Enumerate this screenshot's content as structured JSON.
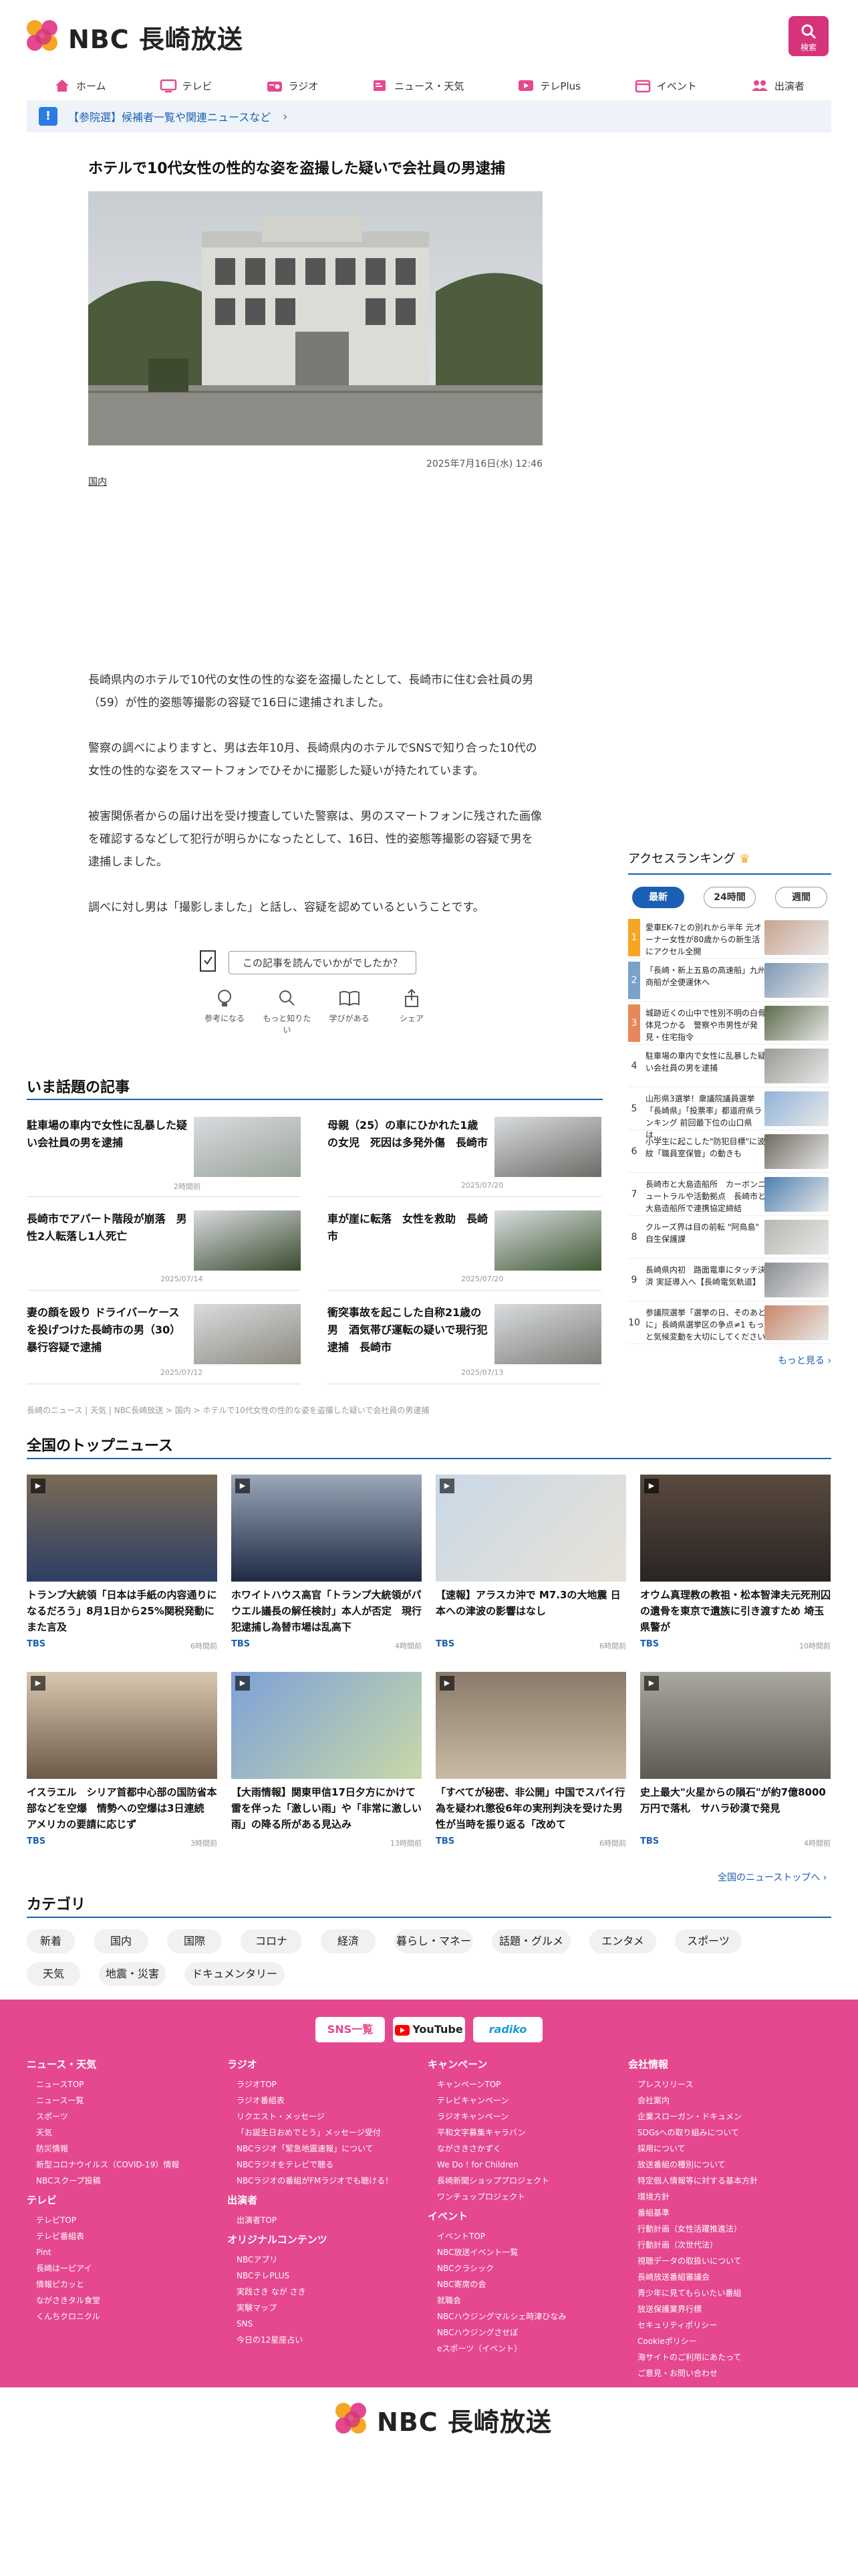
{
  "header": {
    "brand": "NBC 長崎放送",
    "search_label": "検索"
  },
  "nav": [
    "ホーム",
    "テレビ",
    "ラジオ",
    "ニュース・天気",
    "テレPlus",
    "イベント",
    "出演者"
  ],
  "notice": "【参院選】候補者一覧や関連ニュースなど",
  "article": {
    "title": "ホテルで10代女性の性的な姿を盗撮した疑いで会社員の男逮捕",
    "date": "2025年7月16日(水) 12:46",
    "category": "国内",
    "paragraphs": [
      "長崎県内のホテルで10代の女性の性的な姿を盗撮したとして、長崎市に住む会社員の男（59）が性的姿態等撮影の容疑で16日に逮捕されました。",
      "警察の調べによりますと、男は去年10月、長崎県内のホテルでSNSで知り合った10代の女性の性的な姿をスマートフォンでひそかに撮影した疑いが持たれています。",
      "被害関係者からの届け出を受け捜査していた警察は、男のスマートフォンに残された画像を確認するなどして犯行が明らかになったとして、16日、性的姿態等撮影の容疑で男を逮捕しました。",
      "調べに対し男は「撮影しました」と話し、容疑を認めているということです。"
    ]
  },
  "feedback": {
    "prompt": "この記事を読んでいかがでしたか？",
    "reactions": [
      "参考になる",
      "もっと知りたい",
      "学びがある",
      "シェア"
    ]
  },
  "ranking": {
    "title": "アクセスランキング",
    "tabs": [
      "最新",
      "24時間",
      "週間"
    ],
    "items": [
      "愛車EK-7との別れから半年 元オーナー女性が80歳からの新生活にアクセル全開",
      "「長崎・新上五島の高速船」九州商船が全便運休へ",
      "城跡近くの山中で性別不明の白骨体見つかる　警察や市男性が発見・住宅指令",
      "駐車場の車内で女性に乱暴した疑い会社員の男を逮捕",
      "山形県3選挙！衆議院議員選挙「長崎県」「投票率」都道府県ランキング 前回最下位の山口県は…",
      "小学生に起こした\"防犯目標\"に波紋「職員室保管」の動きも",
      "長崎市と大島造船所　カーボンニュートラルや活動拠点　長崎市と大島造船所で連携協定締結",
      "クルーズ界は目の前転 \"阿鳥島\"　自生保護課",
      "長崎県内初　路面電車にタッチ決済 実証導入へ【長崎電気軌道】",
      "参議院選挙「選挙の日、そのあとに」長崎県選挙区の争点≠1 もっと気候変動を大切にしてください"
    ],
    "more": "もっと見る"
  },
  "topics": {
    "title": "いま話題の記事",
    "items": [
      {
        "title": "駐車場の車内で女性に乱暴した疑い会社員の男を逮捕",
        "date": "2時間前"
      },
      {
        "title": "母親（25）の車にひかれた1歳の女児　死因は多発外傷　長崎市",
        "date": "2025/07/20"
      },
      {
        "title": "長崎市でアパート階段が崩落　男性2人転落し1人死亡",
        "date": "2025/07/14"
      },
      {
        "title": "車が崖に転落　女性を救助　長崎市",
        "date": "2025/07/20"
      },
      {
        "title": "妻の顔を殴り ドライバーケースを投げつけた長崎市の男（30）暴行容疑で逮捕",
        "date": "2025/07/12"
      },
      {
        "title": "衝突事故を起こした自称21歳の男　酒気帯び運転の疑いで現行犯逮捕　長崎市",
        "date": "2025/07/13"
      }
    ]
  },
  "breadcrumb": "長崎のニュース | 天気 | NBC長崎放送 > 国内 > ホテルで10代女性の性的な姿を盗撮した疑いで会社員の男逮捕",
  "national": {
    "title": "全国のトップニュース",
    "cards": [
      {
        "title": "トランプ大統領「日本は手紙の内容通りになるだろう」8月1日から25%関税発動にまた言及",
        "src": "TBS",
        "time": "6時間前"
      },
      {
        "title": "ホワイトハウス高官「トランプ大統領がパウエル議長の解任検討」本人が否定　現行犯逮捕し為替市場は乱高下",
        "src": "TBS",
        "time": "4時間前"
      },
      {
        "title": "【速報】アラスカ沖で M7.3の大地震 日本への津波の影響はなし",
        "src": "TBS",
        "time": "6時間前"
      },
      {
        "title": "オウム真理教の教祖・松本智津夫元死刑囚の遺骨を東京で遺族に引き渡すため 埼玉県警が",
        "src": "TBS",
        "time": "10時間前"
      },
      {
        "title": "イスラエル　シリア首都中心部の国防省本部などを空爆　情勢への空爆は3日連続　アメリカの要請に応じず",
        "src": "TBS",
        "time": "3時間前"
      },
      {
        "title": "【大雨情報】関東甲信17日夕方にかけて雷を伴った「激しい雨」や「非常に激しい雨」の降る所がある見込み",
        "src": "",
        "time": "13時間前"
      },
      {
        "title": "「すべてが秘密、非公開」中国でスパイ行為を疑われ懲役6年の実刑判決を受けた男性が当時を振り返る「改めて",
        "src": "TBS",
        "time": "6時間前"
      },
      {
        "title": "史上最大\"火星からの隕石\"が約7億8000万円で落札　サハラ砂漠で発見",
        "src": "TBS",
        "time": "4時間前"
      }
    ],
    "more": "全国のニューストップへ"
  },
  "categories": {
    "title": "カテゴリ",
    "items": [
      "新着",
      "国内",
      "国際",
      "コロナ",
      "経済",
      "暮らし・マネー",
      "話題・グルメ",
      "エンタメ",
      "スポーツ",
      "天気",
      "地震・災害",
      "ドキュメンタリー"
    ]
  },
  "footer": {
    "sns": [
      "SNS一覧",
      "YouTube",
      "radiko"
    ],
    "columns": [
      {
        "sections": [
          {
            "head": "ニュース・天気",
            "links": [
              "ニュースTOP",
              "ニュース一覧",
              "スポーツ",
              "天気",
              "防災情報",
              "新型コロナウイルス（COVID-19）情報",
              "NBCスクープ投稿"
            ]
          },
          {
            "head": "テレビ",
            "links": [
              "テレビTOP",
              "テレビ番組表",
              "Pint",
              "長崎は一ピアイ",
              "情報ピカッと",
              "ながさきタル食堂",
              "くんちクロニクル"
            ]
          }
        ]
      },
      {
        "sections": [
          {
            "head": "ラジオ",
            "links": [
              "ラジオTOP",
              "ラジオ番組表",
              "リクエスト・メッセージ",
              "「お誕生日おめでとう」メッセージ受付",
              "NBCラジオ「緊急地震速報」について",
              "NBCラジオをテレビで聴る",
              "NBCラジオの番組がFMラジオでも聴ける！"
            ]
          },
          {
            "head": "出演者",
            "links": [
              "出演者TOP"
            ]
          },
          {
            "head": "オリジナルコンテンツ",
            "links": [
              "NBCアプリ",
              "NBCテレPLUS",
              "実践さき なが さき",
              "実験マップ",
              "SNS",
              "今日の12星座占い"
            ]
          }
        ]
      },
      {
        "sections": [
          {
            "head": "キャンペーン",
            "links": [
              "キャンペーンTOP",
              "テレビキャンペーン",
              "ラジオキャンペーン",
              "平和文字募集キャラバン",
              "ながさきさかずく",
              "We Do ! for Children",
              "長崎新聞ショッププロジェクト",
              "ワンチュップロジェクト"
            ]
          },
          {
            "head": "イベント",
            "links": [
              "イベントTOP",
              "NBC放送イベント一覧",
              "NBCクラシック",
              "NBC寄席の会",
              "就職会",
              "NBCハウジングマルシェ時津ひなみ",
              "NBCハウジングさせぼ",
              "eスポーツ（イベント）"
            ]
          }
        ]
      },
      {
        "sections": [
          {
            "head": "会社情報",
            "links": [
              "プレスリリース",
              "会社案内",
              "企業スローガン・ドキュメン",
              "SDGsへの取り組みについて",
              "採用について",
              "放送番組の種別について",
              "特定個人情報等に対する基本方針",
              "環境方針",
              "番組基準",
              "行動計画（女性活躍推進法）",
              "行動計画（次世代法）",
              "視聴データの取扱いについて",
              "長崎放送番組審議会",
              "青少年に見てもらいたい番組",
              "放送保護業界行標",
              "セキュリティポリシー",
              "Cookieポリシー",
              "海サイトのご利用にあたって",
              "ご意見・お問い合わせ"
            ]
          }
        ]
      }
    ]
  },
  "colors": {
    "brand_pink": "#e5488e",
    "link_blue": "#1a5fb4",
    "search_bg": "#d6337a"
  }
}
